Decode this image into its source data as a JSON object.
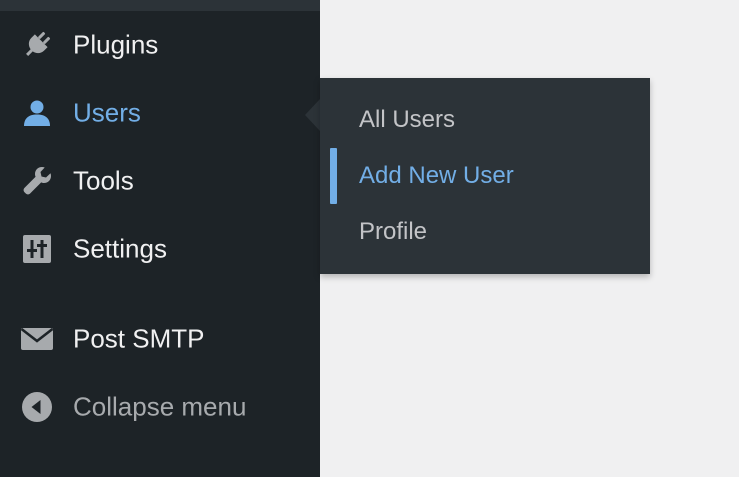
{
  "colors": {
    "sidebar_bg": "#1d2327",
    "submenu_bg": "#2c3338",
    "accent": "#72aee6",
    "text": "#f0f0f1",
    "muted_text": "#a7aaad",
    "content_bg": "#f0f0f1"
  },
  "sidebar": {
    "items": [
      {
        "label": "Plugins",
        "icon": "plugin-icon"
      },
      {
        "label": "Users",
        "icon": "users-icon",
        "state": "active"
      },
      {
        "label": "Tools",
        "icon": "wrench-icon"
      },
      {
        "label": "Settings",
        "icon": "settings-sliders-icon"
      },
      {
        "label": "Post SMTP",
        "icon": "envelope-icon"
      },
      {
        "label": "Collapse menu",
        "icon": "collapse-arrow-icon"
      }
    ]
  },
  "submenu": {
    "parent": "Users",
    "items": [
      {
        "label": "All Users"
      },
      {
        "label": "Add New User",
        "state": "current"
      },
      {
        "label": "Profile"
      }
    ]
  }
}
